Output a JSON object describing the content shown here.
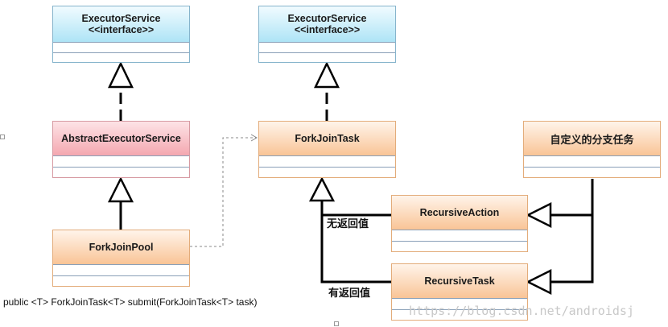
{
  "boxes": {
    "executor_service_left": {
      "name": "ExecutorService",
      "stereotype": "<<interface>>"
    },
    "executor_service_right": {
      "name": "ExecutorService",
      "stereotype": "<<interface>>"
    },
    "abstract_executor_service": {
      "name": "AbstractExecutorService"
    },
    "fork_join_pool": {
      "name": "ForkJoinPool"
    },
    "fork_join_task": {
      "name": "ForkJoinTask"
    },
    "custom_task": {
      "name": "自定义的分支任务"
    },
    "recursive_action": {
      "name": "RecursiveAction"
    },
    "recursive_task": {
      "name": "RecursiveTask"
    }
  },
  "labels": {
    "no_return": "无返回值",
    "has_return": "有返回值"
  },
  "signature": "public <T> ForkJoinTask<T> submit(ForkJoinTask<T> task)",
  "watermark": "https://blog.csdn.net/androidsj",
  "colors": {
    "interface_fill": "#aee4f6",
    "abstract_fill": "#f4a7b0",
    "class_fill": "#f9c496",
    "line": "#000000",
    "dashed_link": "#888888"
  }
}
